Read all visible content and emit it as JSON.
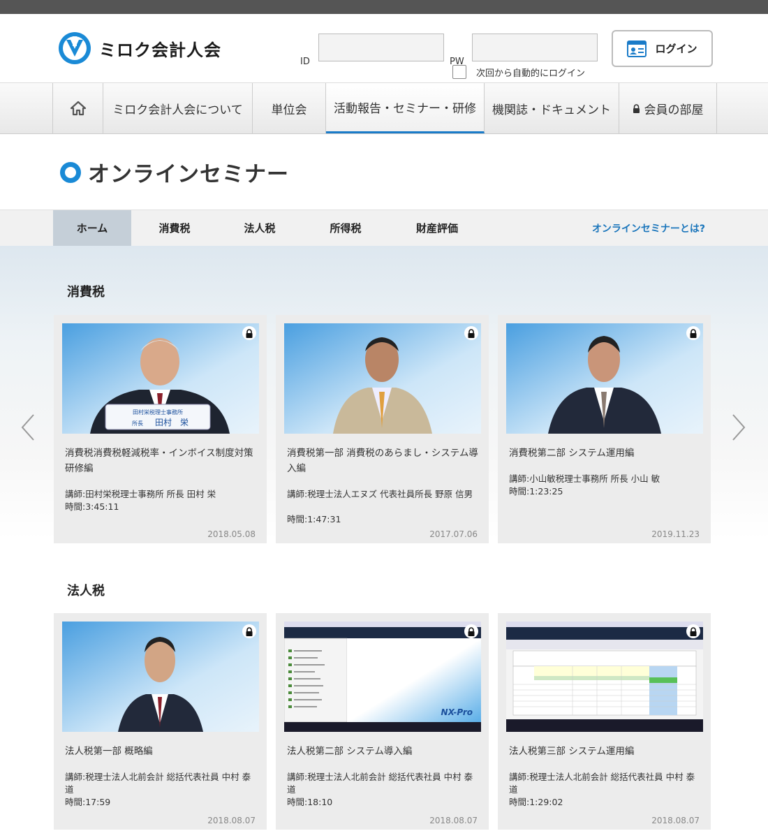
{
  "header": {
    "logo_text": "ミロク会計人会",
    "id_label": "ID",
    "pw_label": "PW",
    "id_value": "",
    "pw_value": "",
    "remember_label": "次回から自動的にログイン",
    "login_label": "ログイン"
  },
  "gnav": {
    "items": [
      {
        "label": "ミロク会計人会について"
      },
      {
        "label": "単位会"
      },
      {
        "label": "活動報告・セミナー・研修"
      },
      {
        "label": "機関誌・ドキュメント"
      },
      {
        "label": "会員の部屋"
      }
    ]
  },
  "page": {
    "title": "オンラインセミナー"
  },
  "subnav": {
    "items": [
      {
        "label": "ホーム"
      },
      {
        "label": "消費税"
      },
      {
        "label": "法人税"
      },
      {
        "label": "所得税"
      },
      {
        "label": "財産評価"
      }
    ],
    "about_label": "オンラインセミナーとは?"
  },
  "sections": [
    {
      "title": "消費税",
      "cards": [
        {
          "title": "消費税消費税軽減税率・インボイス制度対策研修編",
          "lecturer": "講師:田村栄税理士事務所 所長 田村 栄",
          "duration": "時間:3:45:11",
          "date": "2018.05.08",
          "caption_office": "田村栄税理士事務所",
          "caption_role": "所長",
          "caption_name": "田村　栄"
        },
        {
          "title": "消費税第一部 消費税のあらまし・システム導入編",
          "lecturer": "講師:税理士法人エヌズ 代表社員所長 野原 信男",
          "duration": "時間:1:47:31",
          "date": "2017.07.06"
        },
        {
          "title": "消費税第二部 システム運用編",
          "lecturer": "講師:小山敏税理士事務所 所長 小山 敏",
          "duration": "時間:1:23:25",
          "date": "2019.11.23"
        }
      ]
    },
    {
      "title": "法人税",
      "cards": [
        {
          "title": "法人税第一部 概略編",
          "lecturer": "講師:税理士法人北前会計 総括代表社員 中村 泰道",
          "duration": "時間:17:59",
          "date": "2018.08.07"
        },
        {
          "title": "法人税第二部 システム導入編",
          "lecturer": "講師:税理士法人北前会計 総括代表社員 中村 泰道",
          "duration": "時間:18:10",
          "date": "2018.08.07",
          "brand": "NX-Pro"
        },
        {
          "title": "法人税第三部 システム運用編",
          "lecturer": "講師:税理士法人北前会計 総括代表社員 中村 泰道",
          "duration": "時間:1:29:02",
          "date": "2018.08.07"
        }
      ]
    }
  ],
  "colors": {
    "accent": "#1a7bc8",
    "link": "#1a75bb",
    "subnav_active": "#c5cfd8"
  },
  "icons": {
    "logo": "miroku-logo-icon",
    "login": "id-card-icon",
    "home": "home-icon",
    "lock": "lock-icon",
    "prev": "chevron-left-icon",
    "next": "chevron-right-icon"
  }
}
